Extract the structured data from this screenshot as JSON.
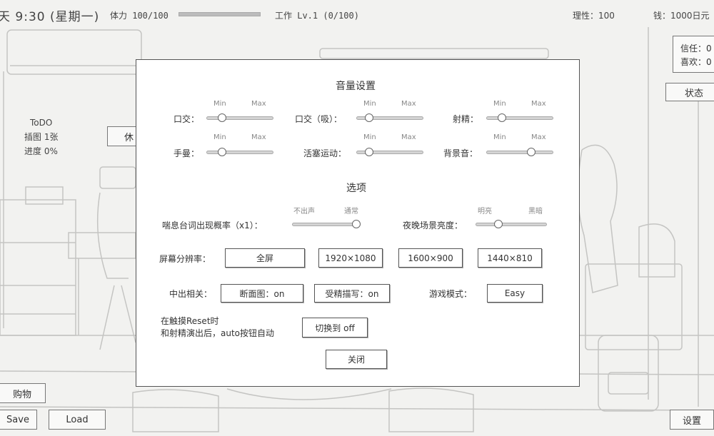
{
  "hud": {
    "time": "天 9:30 (星期一)",
    "stamina_label": "体力 100/100",
    "stamina_fraction": 1.0,
    "work": "工作 Lv.1 (0/100)",
    "reason": "理性：100",
    "money": "钱：1000日元"
  },
  "todo": {
    "title": "ToDO",
    "line1": "插图 1张",
    "line2": "进度 0%"
  },
  "side": {
    "partial_button": "休",
    "trust": "信任：0",
    "like": "喜欢：0",
    "status_button": "状态",
    "shop_button": "购物",
    "save_button": "Save",
    "load_button": "Load",
    "settings_button": "设置"
  },
  "modal": {
    "volume_title": "音量设置",
    "min": "Min",
    "max": "Max",
    "volume_sliders": [
      {
        "label": "口交：",
        "value": 0.2
      },
      {
        "label": "口交（吸）：",
        "value": 0.15
      },
      {
        "label": "射精：",
        "value": 0.2
      },
      {
        "label": "手曼：",
        "value": 0.2
      },
      {
        "label": "活塞运动：",
        "value": 0.15
      },
      {
        "label": "背景音：",
        "value": 0.7
      }
    ],
    "options_title": "选项",
    "moan": {
      "label": "喘息台词出现概率（x1）：",
      "low": "不出声",
      "high": "通常",
      "value": 1.0
    },
    "night": {
      "label": "夜晚场景亮度：",
      "low": "明亮",
      "high": "黑暗",
      "value": 0.3
    },
    "resolution": {
      "label": "屏幕分辨率：",
      "options": [
        "全屏",
        "1920×1080",
        "1600×900",
        "1440×810"
      ]
    },
    "creampie": {
      "label": "中出相关：",
      "cross_section": "断面图：on",
      "depiction": "受精描写：on"
    },
    "game_mode": {
      "label": "游戏模式：",
      "value": "Easy"
    },
    "auto": {
      "line1": "在触摸Reset时",
      "line2": "和射精演出后，auto按钮自动",
      "button": "切换到 off"
    },
    "close": "关闭"
  }
}
